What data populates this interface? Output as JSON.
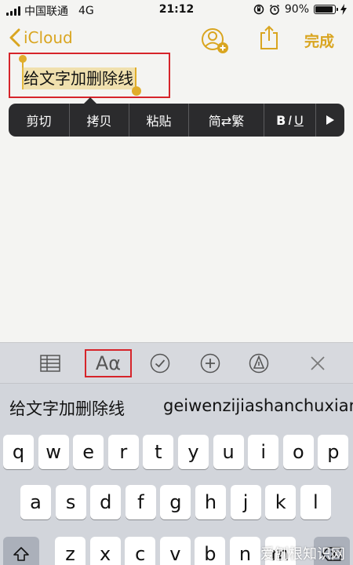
{
  "status_bar": {
    "carrier": "中国联通",
    "network": "4G",
    "time": "21:12",
    "battery": "90%",
    "battery_level": 0.9
  },
  "nav": {
    "back_label": "iCloud",
    "done_label": "完成",
    "accent_color": "#d9a520"
  },
  "note": {
    "selected_text": "给文字加删除线"
  },
  "edit_menu": {
    "items": [
      "剪切",
      "拷贝",
      "粘贴",
      "简⇄繁"
    ],
    "format_b": "B",
    "format_i": "I",
    "format_u": "U"
  },
  "format_toolbar": {
    "text_style_label": "Aα"
  },
  "suggestions": {
    "items": [
      "给文字加删除线",
      "geiwenzijiashanchuxian"
    ]
  },
  "keyboard": {
    "row1": [
      "q",
      "w",
      "e",
      "r",
      "t",
      "y",
      "u",
      "i",
      "o",
      "p"
    ],
    "row2": [
      "a",
      "s",
      "d",
      "f",
      "g",
      "h",
      "j",
      "k",
      "l"
    ],
    "row3": [
      "z",
      "x",
      "c",
      "v",
      "b",
      "n",
      "m"
    ]
  },
  "watermark": "爱刨根知识网"
}
